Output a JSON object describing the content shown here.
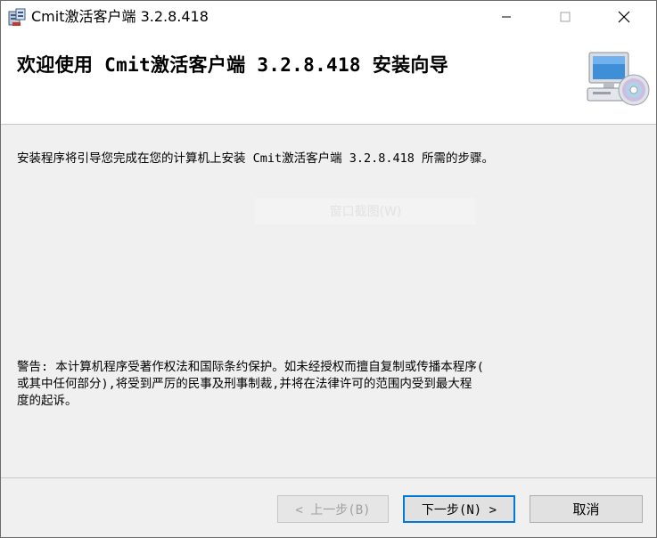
{
  "window": {
    "title": "Cmit激活客户端 3.2.8.418",
    "controls": {
      "minimize": "—",
      "maximize": "☐",
      "close": "✕"
    }
  },
  "header": {
    "title": "欢迎使用 Cmit激活客户端 3.2.8.418 安装向导",
    "icon": "computer-cd-icon"
  },
  "content": {
    "description": "安装程序将引导您完成在您的计算机上安装 Cmit激活客户端 3.2.8.418 所需的步骤。",
    "ghost_button": "窗口截图(W)",
    "warning": "警告: 本计算机程序受著作权法和国际条约保护。如未经授权而擅自复制或传播本程序(\n或其中任何部分),将受到严厉的民事及刑事制裁,并将在法律许可的范围内受到最大程\n度的起诉。"
  },
  "footer": {
    "back_label": "< 上一步(B)",
    "next_label": "下一步(N) >",
    "cancel_label": "取消"
  },
  "colors": {
    "accent": "#0078d7",
    "background": "#f0f0f0",
    "header_background": "#ffffff"
  }
}
